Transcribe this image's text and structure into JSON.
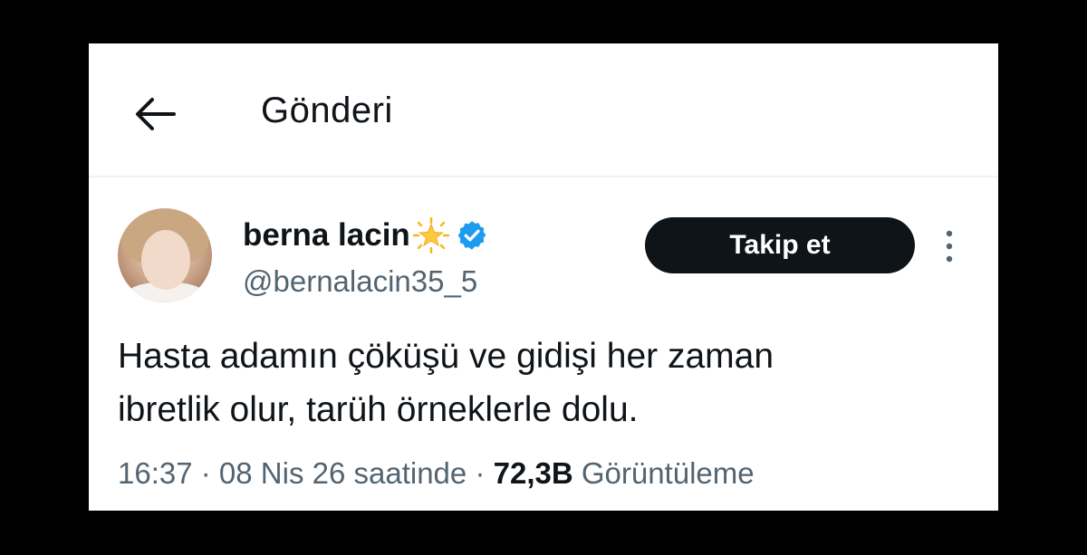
{
  "header": {
    "title": "Gönderi"
  },
  "tweet": {
    "author": {
      "name": "berna lacin",
      "handle": "@bernalacin35_5"
    },
    "follow_label": "Takip et",
    "text_line1": "Hasta adamın çöküşü ve gidişi her zaman",
    "text_line2": "ibretlik olur, tarüh örneklerle dolu.",
    "time": "16:37",
    "date": "08 Nis 26 saatinde",
    "separator": " · ",
    "views_count": "72,3B",
    "views_label": "Görüntüleme"
  },
  "icons": {
    "back": "arrow-left-icon",
    "star": "glowing-star-emoji",
    "verified": "verified-badge-icon",
    "more": "more-vertical-icon"
  },
  "colors": {
    "background": "#000000",
    "card": "#ffffff",
    "text": "#0f1419",
    "secondary": "#536471",
    "verified": "#1d9bf0",
    "button": "#0f1419"
  }
}
